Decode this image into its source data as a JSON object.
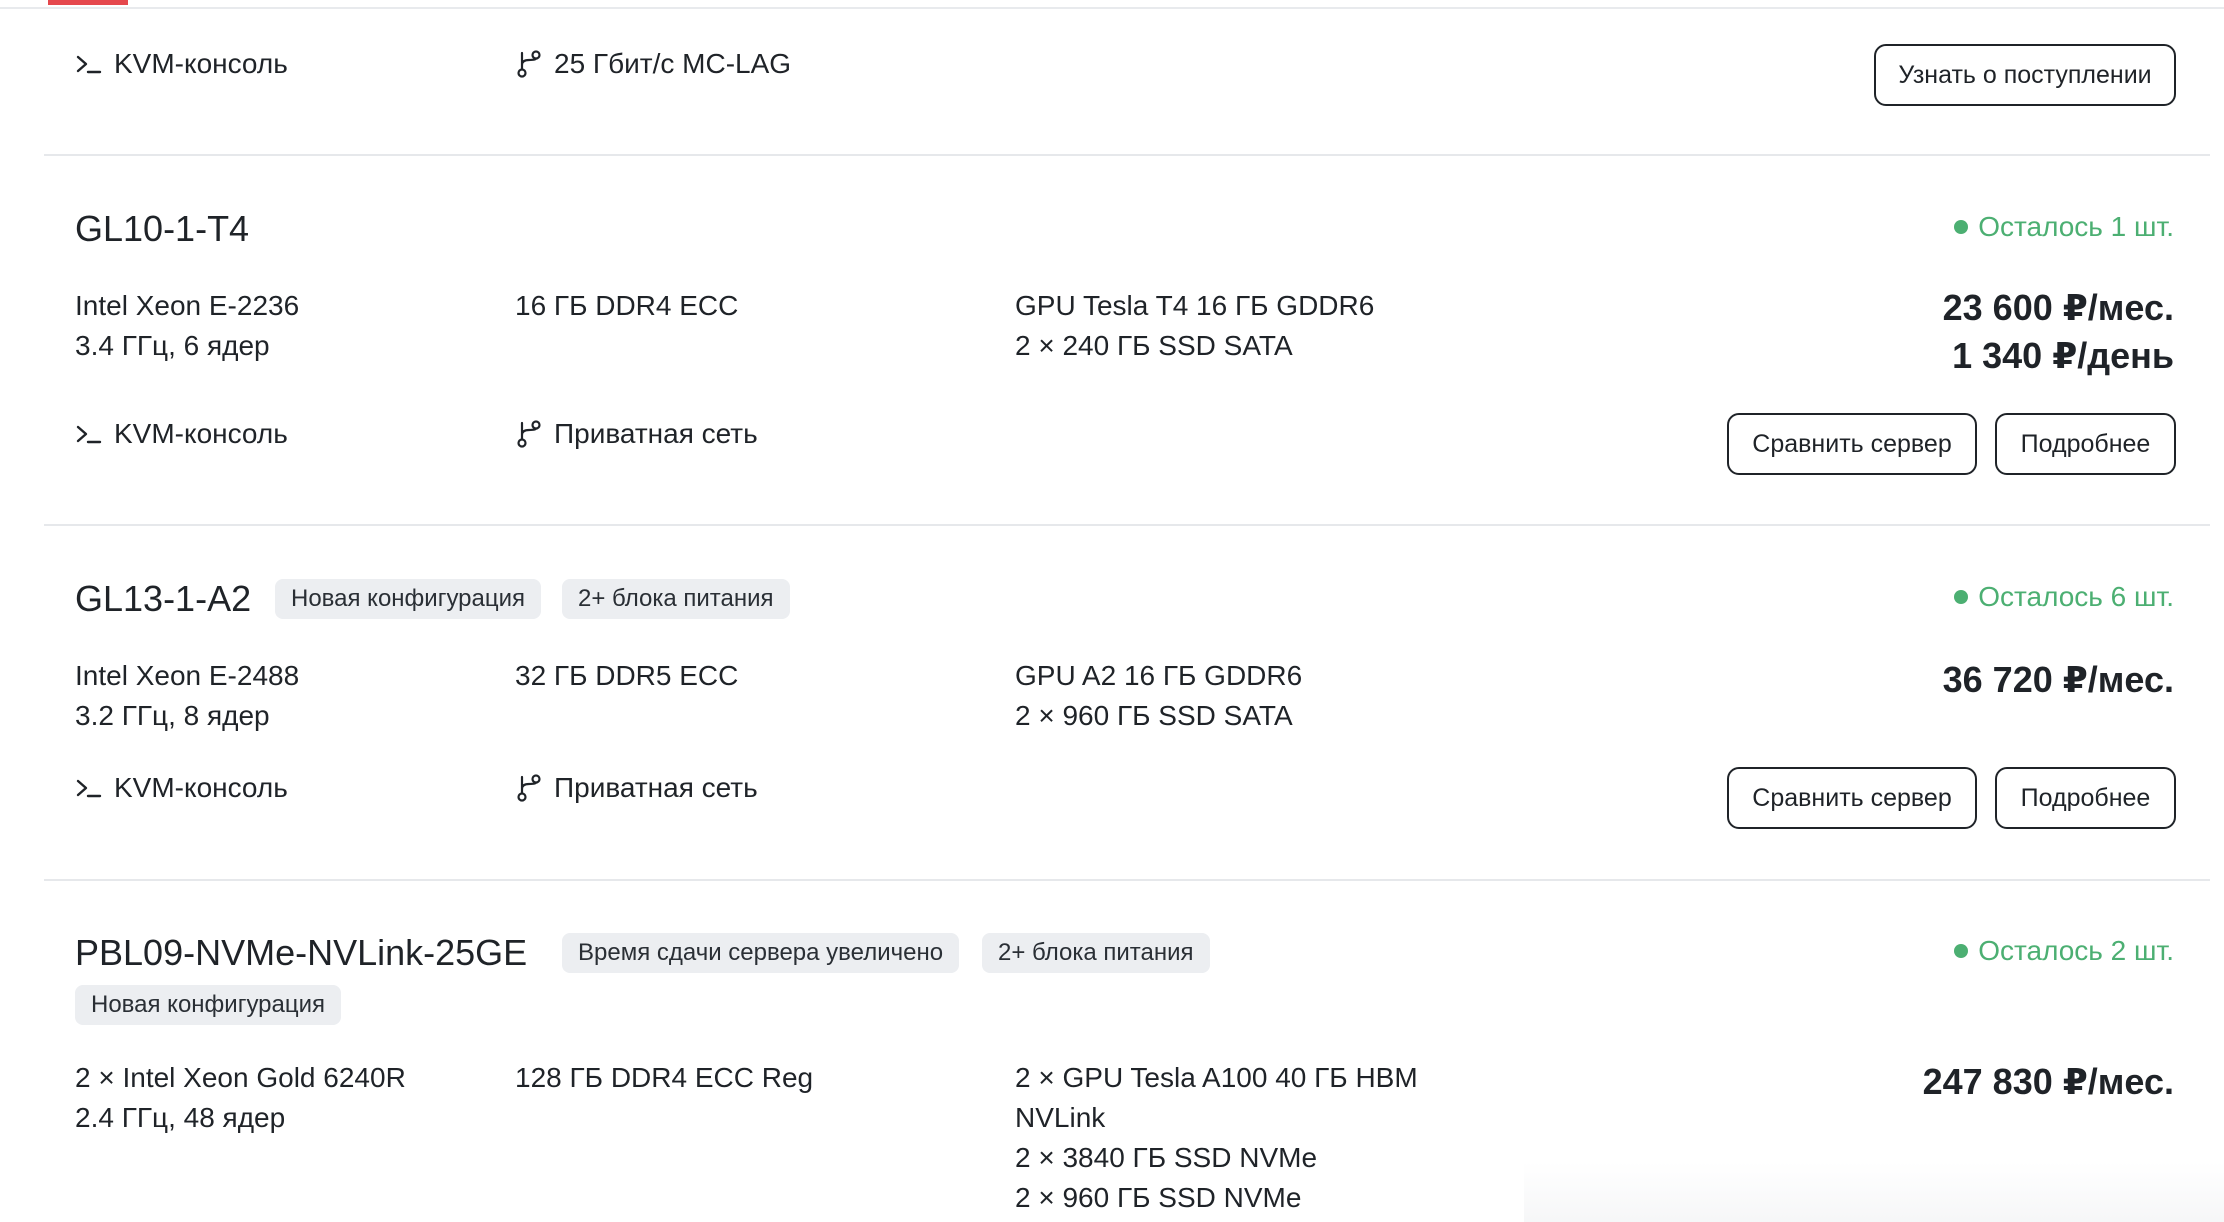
{
  "colors": {
    "accent": "#e5484d",
    "stock": "#4caf72",
    "text": "#1f2328",
    "tag_bg": "#eceef1"
  },
  "icons": {
    "console": "terminal-prompt-icon",
    "network": "branch-network-icon"
  },
  "top_partial": {
    "feature_console": "KVM-консоль",
    "feature_network": "25 Гбит/с MC-LAG",
    "notify_button": "Узнать о поступлении"
  },
  "servers": [
    {
      "name": "GL10-1-T4",
      "tags": [],
      "stock": "Осталось 1 шт.",
      "cpu_line1": "Intel Xeon E-2236",
      "cpu_line2": "3.4 ГГц, 6 ядер",
      "ram": "16 ГБ DDR4 ECC",
      "storage": [
        "GPU Tesla T4 16 ГБ GDDR6",
        "2 × 240 ГБ SSD SATA"
      ],
      "price_month": "23 600 ₽/мес.",
      "price_day": "1 340 ₽/день",
      "feature_console": "KVM-консоль",
      "feature_network": "Приватная сеть",
      "compare_button": "Сравнить сервер",
      "details_button": "Подробнее"
    },
    {
      "name": "GL13-1-A2",
      "tags": [
        "Новая конфигурация",
        "2+ блока питания"
      ],
      "stock": "Осталось 6 шт.",
      "cpu_line1": "Intel Xeon E-2488",
      "cpu_line2": "3.2 ГГц, 8 ядер",
      "ram": "32 ГБ DDR5 ECC",
      "storage": [
        "GPU A2 16 ГБ GDDR6",
        "2 × 960 ГБ SSD SATA"
      ],
      "price_month": "36 720 ₽/мес.",
      "feature_console": "KVM-консоль",
      "feature_network": "Приватная сеть",
      "compare_button": "Сравнить сервер",
      "details_button": "Подробнее"
    },
    {
      "name": "PBL09-NVMe-NVLink-25GE",
      "tags": [
        "Время сдачи сервера увеличено",
        "2+ блока питания",
        "Новая конфигурация"
      ],
      "stock": "Осталось 2 шт.",
      "cpu_line1": "2 × Intel Xeon Gold 6240R",
      "cpu_line2": "2.4 ГГц, 48 ядер",
      "ram": "128 ГБ DDR4 ECC Reg",
      "storage": [
        "2 × GPU Tesla A100 40 ГБ HBM",
        "NVLink",
        "2 × 3840 ГБ SSD NVMe",
        "2 × 960 ГБ SSD NVMe"
      ],
      "price_month": "247 830 ₽/мес."
    }
  ]
}
